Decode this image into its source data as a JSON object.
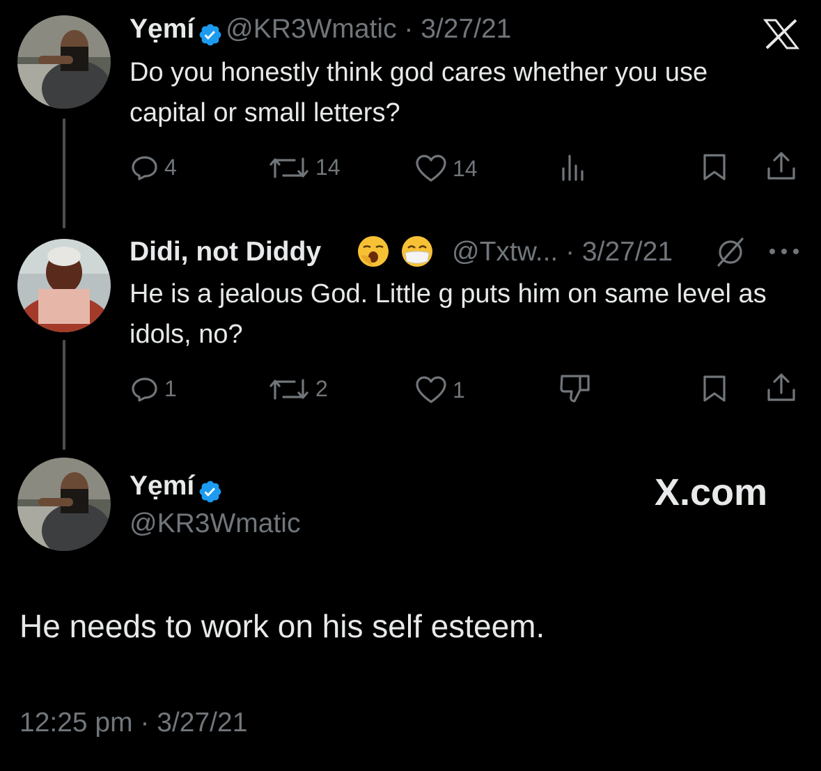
{
  "tweet1": {
    "name": "Yẹmí",
    "handle_date": "@KR3Wmatic · 3/27/21",
    "text": "Do you honestly think god cares whether you use capital or small letters?",
    "replies": "4",
    "retweets": "14",
    "likes": "14"
  },
  "tweet2": {
    "name": "Didi, not Diddy",
    "handle_date": "@Txtw... · 3/27/21",
    "text": "He is a jealous God. Little g puts him on same level as idols, no?",
    "replies": "1",
    "retweets": "2",
    "likes": "1"
  },
  "main_tweet": {
    "name": "Yẹmí",
    "handle": "@KR3Wmatic",
    "text": "He needs to work on his self esteem.",
    "timestamp": "12:25 pm · 3/27/21"
  },
  "brand": {
    "watermark": "X.com",
    "logo": "X"
  },
  "icons": {
    "reply": "reply-icon",
    "retweet": "retweet-icon",
    "like": "heart-icon",
    "views": "views-icon",
    "dislike": "thumbs-down-icon",
    "bookmark": "bookmark-icon",
    "share": "share-icon",
    "verified": "verified-badge-icon",
    "more": "more-icon",
    "muted": "slash-circle-icon"
  },
  "colors": {
    "background": "#000000",
    "text": "#e7e9ea",
    "muted": "#71767b",
    "verified": "#1d9bf0"
  }
}
